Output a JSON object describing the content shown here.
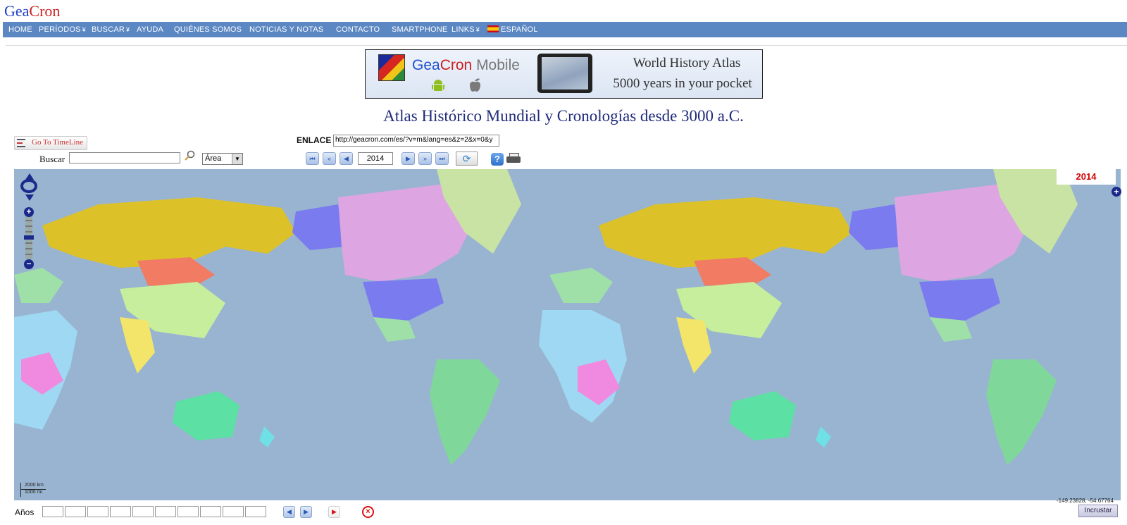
{
  "header": {
    "logo_part1": "Gea",
    "logo_part2": "Cron"
  },
  "nav": {
    "items": [
      {
        "label": "HOME",
        "has_menu": false
      },
      {
        "label": "PERÍODOS",
        "has_menu": true
      },
      {
        "label": "BUSCAR",
        "has_menu": true
      },
      {
        "label": "AYUDA",
        "has_menu": false
      },
      {
        "label": "QUIÉNES SOMOS",
        "has_menu": false
      },
      {
        "label": "NOTICIAS Y NOTAS",
        "has_menu": false
      },
      {
        "label": "CONTACTO",
        "has_menu": false
      },
      {
        "label": "SMARTPHONE",
        "has_menu": false
      },
      {
        "label": "LINKS",
        "has_menu": true
      }
    ],
    "menu_caret": "¥",
    "language": "ESPAÑOL"
  },
  "banner": {
    "brand_part1": "Gea",
    "brand_part2": "Cron",
    "brand_part3": " Mobile",
    "line1": "World History Atlas",
    "line2": "5000 years in your pocket"
  },
  "page_title": "Atlas Histórico Mundial y Cronologías desde 3000 a.C.",
  "toolbar": {
    "timeline_label": "Go To TimeLine",
    "search_label": "Buscar",
    "search_value": "",
    "area_selected": "Área",
    "enlace_label": "ENLACE",
    "enlace_value": "http://geacron.com/es/?v=m&lang=es&z=2&x=0&y",
    "year_value": "2014",
    "help_glyph": "?"
  },
  "map": {
    "year_badge": "2014",
    "scale_km": "2000 km",
    "scale_mi": "1000 mi",
    "coordinates": "-149.23828, -54.67764",
    "ocean_color": "#99b4d0"
  },
  "footer": {
    "anos_label": "Años",
    "embed_label": "Incrustar"
  },
  "icons": {
    "first": "⏮",
    "back_fast": "«",
    "back": "◀",
    "fwd": "▶",
    "fwd_fast": "»",
    "last": "⏭",
    "refresh": "⟳",
    "search": "🔍",
    "android": "☗",
    "apple": "●",
    "expand": "+",
    "zoom_in": "+",
    "zoom_out": "−",
    "stop": "⊗"
  }
}
